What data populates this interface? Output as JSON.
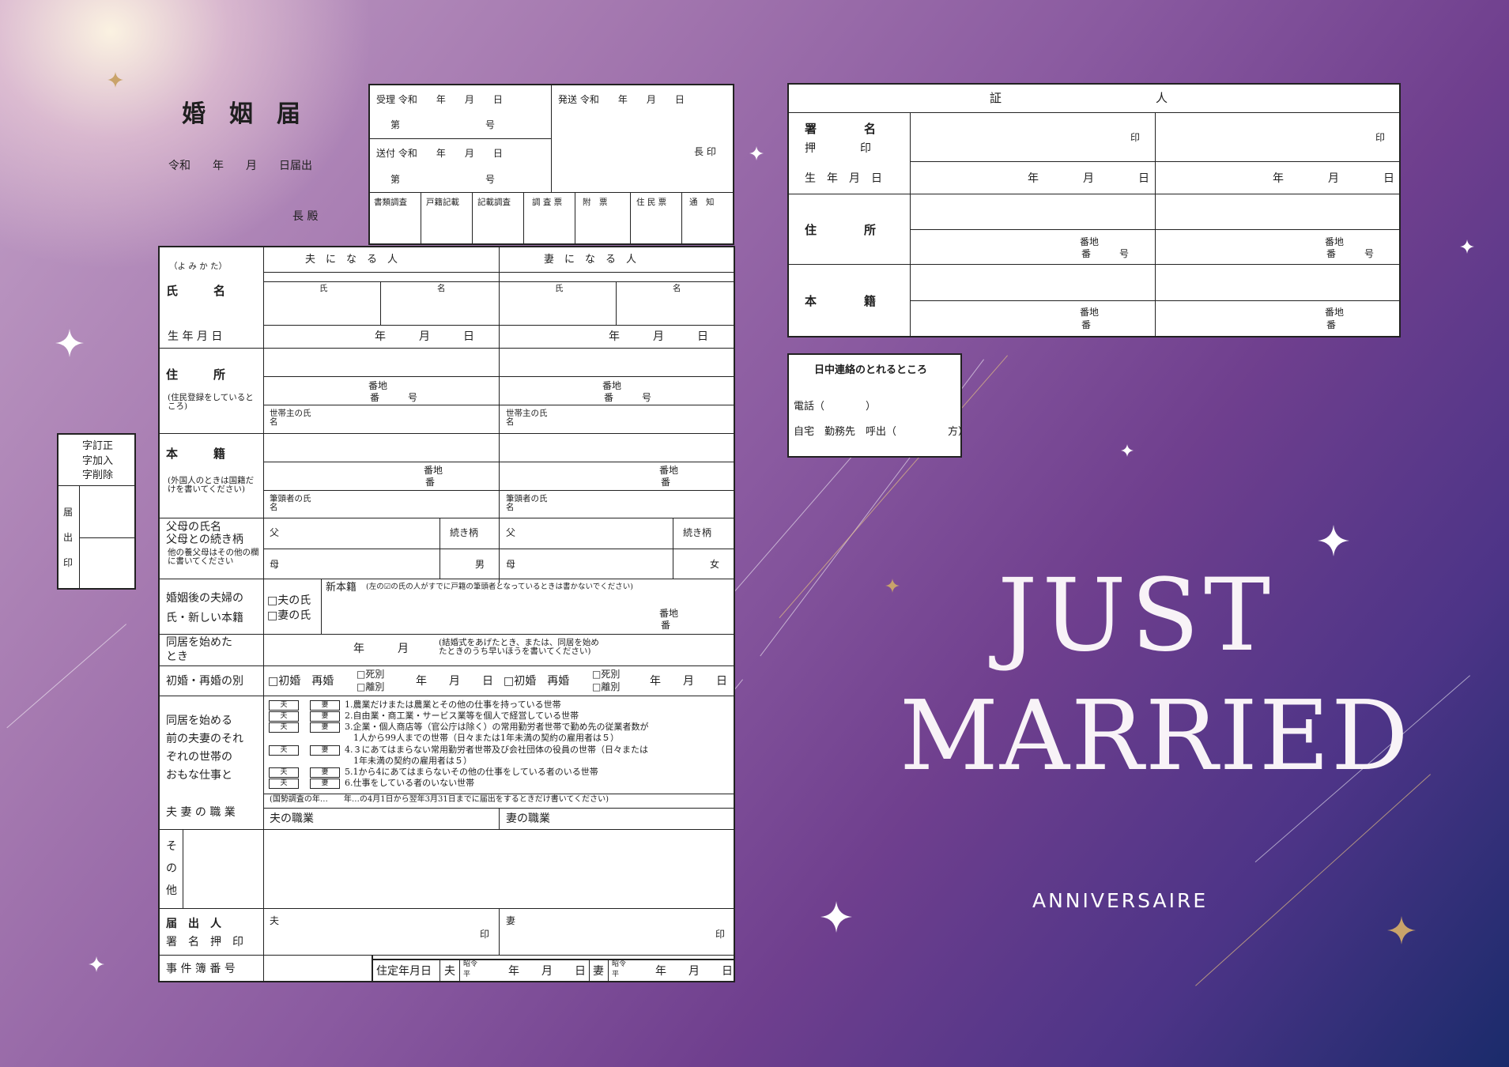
{
  "colors": {
    "bg_start": "#c2a0c6",
    "bg_mid": "#8a5aa0",
    "bg_end": "#1a2b6b",
    "ink": "#222222",
    "line_accent": "#d9b97e"
  },
  "header": {
    "title": "婚　姻　届",
    "date_line": "令和　　年　　月　　日届出",
    "cho": "長 殿"
  },
  "office": {
    "ukei": "受理 令和　　年　　月　　日",
    "ukei_no": "第　　　　　　　　　号",
    "hasso": "発送 令和　　年　　月　　日",
    "sofu": "送付 令和　　年　　月　　日",
    "sofu_no": "第　　　　　　　　　号",
    "cho_in": "長 印",
    "checks": [
      "書類調査",
      "戸籍記載",
      "記載調査",
      "調 査 票",
      "附　票",
      "住 民 票",
      "通　知"
    ]
  },
  "side": {
    "teisei": "字訂正",
    "kanyu": "字加入",
    "sakujo": "字削除",
    "todokede": "届",
    "de": "出",
    "in": "印"
  },
  "main": {
    "yomikata": "（よ み か た）",
    "husband_head": "夫　に　な　る　人",
    "wife_head": "妻　に　な　る　人",
    "shimei": "氏　　　名",
    "shi": "氏",
    "mei": "名",
    "birth": "生 年 月 日",
    "ymd": "年　　　月　　　日",
    "jusho": "住　　　所",
    "jusho_note": "住民登録をしているところ",
    "banchi": "番地",
    "ban": "番",
    "go": "号",
    "setainushi": "世帯主の氏名",
    "honseki": "本　　　籍",
    "honseki_note": "外国人のときは国籍だけを書いてください",
    "hittosha": "筆頭者の氏名",
    "fubo1": "父母の氏名",
    "fubo2": "父母との続き柄",
    "fubo3": "他の養父母はその他の欄に書いてください",
    "chichi": "父",
    "haha": "母",
    "tsuzuki": "続き柄",
    "otoko": "男",
    "onna": "女",
    "kongo1": "婚姻後の夫婦の",
    "kongo2": "氏・新しい本籍",
    "otto_no_uji": "□夫の氏",
    "tsuma_no_uji": "□妻の氏",
    "shin_honseki": "新本籍",
    "shin_note": "(左の☑の氏の人がすでに戸籍の筆頭者となっているときは書かないでください)",
    "dokyo1": "同居を始めた",
    "dokyo2": "とき",
    "ym": "年　　　月",
    "dokyo_note1": "結婚式をあげたとき、または、同居を始め",
    "dokyo_note2": "たときのうち早いほうを書いてください",
    "shokon": "初婚・再婚の別",
    "shokon_h": "□初婚　再婚",
    "shibetsu": "□死別",
    "ribetsu": "□離別",
    "shigoto_label": [
      "同居を始める",
      "前の夫妻のそれ",
      "ぞれの世帯の",
      "おもな仕事と"
    ],
    "otto_tag": "夫",
    "tsuma_tag": "妻",
    "shigoto": [
      "1.農業だけまたは農業とその他の仕事を持っている世帯",
      "2.自由業・商工業・サービス業等を個人で経営している世帯",
      "3.企業・個人商店等（官公庁は除く）の常用勤労者世帯で勤め先の従業者数が",
      "　1人から99人までの世帯（日々または1年未満の契約の雇用者は５）",
      "4.３にあてはまらない常用勤労者世帯及び会社団体の役員の世帯（日々または",
      "　1年未満の契約の雇用者は５）",
      "5.1から4にあてはまらないその他の仕事をしている者のいる世帯",
      "6.仕事をしている者のいない世帯"
    ],
    "shokugyo": "夫 妻 の 職 業",
    "kokusei": "(国勢調査の年…　　年…の4月1日から翌年3月31日までに届出をするときだけ書いてください)",
    "otto_shokugyo": "夫の職業",
    "tsuma_shokugyo": "妻の職業",
    "sonota": [
      "そ",
      "の",
      "他"
    ],
    "todokenin1": "届　出　人",
    "todokenin2": "署　名　押　印",
    "otto": "夫",
    "tsuma": "妻",
    "in": "印",
    "jiken": "事 件 簿 番 号",
    "jutei": "住定年月日",
    "showa": "昭令",
    "hei": "平",
    "ymd2": "年　　月　　日"
  },
  "witness": {
    "header": "証　　　　　　　　　　　　　人",
    "shomei1": "署　　　　名",
    "shomei2": "押　　　　印",
    "in": "印",
    "birth": "生　年　月　日",
    "ymd": "年　　　　月　　　　日",
    "jusho": "住　　　　所",
    "honseki": "本　　　　籍",
    "banchi": "番地",
    "ban": "番",
    "go": "号"
  },
  "contact": {
    "title": "日中連絡のとれるところ",
    "tel": "電話（　　　　）",
    "place": "自宅　勤務先　呼出（　　　　　方）"
  },
  "brand": {
    "line1": "JUST",
    "line2": "MARRIED",
    "logo": "ANNIVERSAIRE"
  }
}
